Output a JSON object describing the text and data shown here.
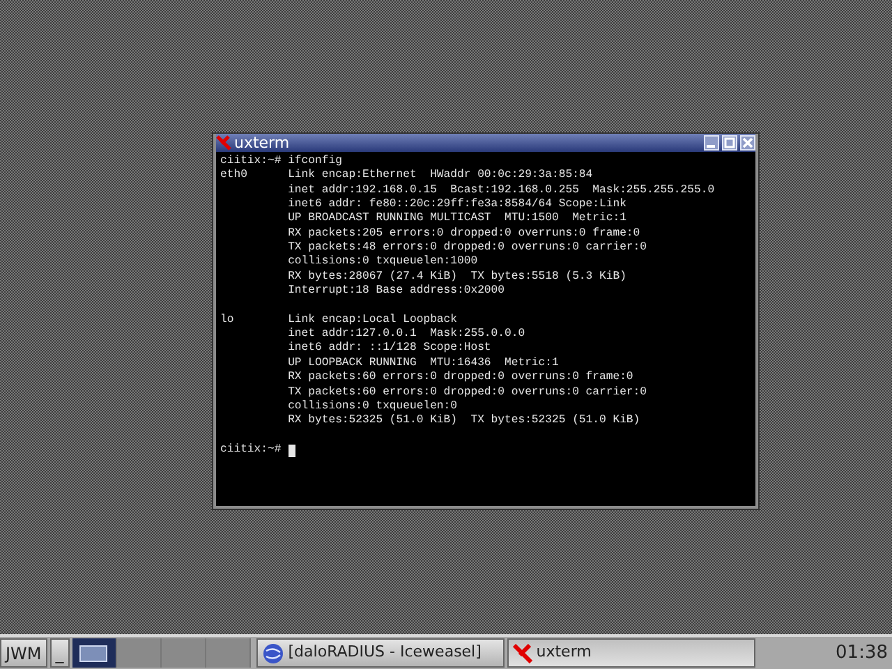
{
  "window": {
    "title": "uxterm",
    "active": true
  },
  "terminal": {
    "blocks": [
      [
        "ciitix:~# ifconfig",
        "eth0      Link encap:Ethernet  HWaddr 00:0c:29:3a:85:84",
        "          inet addr:192.168.0.15  Bcast:192.168.0.255  Mask:255.255.255.0",
        "          inet6 addr: fe80::20c:29ff:fe3a:8584/64 Scope:Link",
        "          UP BROADCAST RUNNING MULTICAST  MTU:1500  Metric:1",
        "          RX packets:205 errors:0 dropped:0 overruns:0 frame:0",
        "          TX packets:48 errors:0 dropped:0 overruns:0 carrier:0",
        "          collisions:0 txqueuelen:1000",
        "          RX bytes:28067 (27.4 KiB)  TX bytes:5518 (5.3 KiB)",
        "          Interrupt:18 Base address:0x2000"
      ],
      [
        "lo        Link encap:Local Loopback",
        "          inet addr:127.0.0.1  Mask:255.0.0.0",
        "          inet6 addr: ::1/128 Scope:Host",
        "          UP LOOPBACK RUNNING  MTU:16436  Metric:1",
        "          RX packets:60 errors:0 dropped:0 overruns:0 frame:0",
        "          TX packets:60 errors:0 dropped:0 overruns:0 carrier:0",
        "          collisions:0 txqueuelen:0",
        "          RX bytes:52325 (51.0 KiB)  TX bytes:52325 (51.0 KiB)"
      ]
    ],
    "prompt": "ciitix:~#"
  },
  "taskbar": {
    "menu_button": "JWM",
    "show_desktop": "_",
    "desktops": [
      {
        "selected": true
      },
      {
        "selected": false
      },
      {
        "selected": false
      },
      {
        "selected": false
      }
    ],
    "tasks": [
      {
        "kind": "browser",
        "label": "[daloRADIUS - Iceweasel]",
        "selected": false
      },
      {
        "kind": "terminal",
        "label": "uxterm",
        "selected": true
      }
    ],
    "clock": "01:38"
  }
}
